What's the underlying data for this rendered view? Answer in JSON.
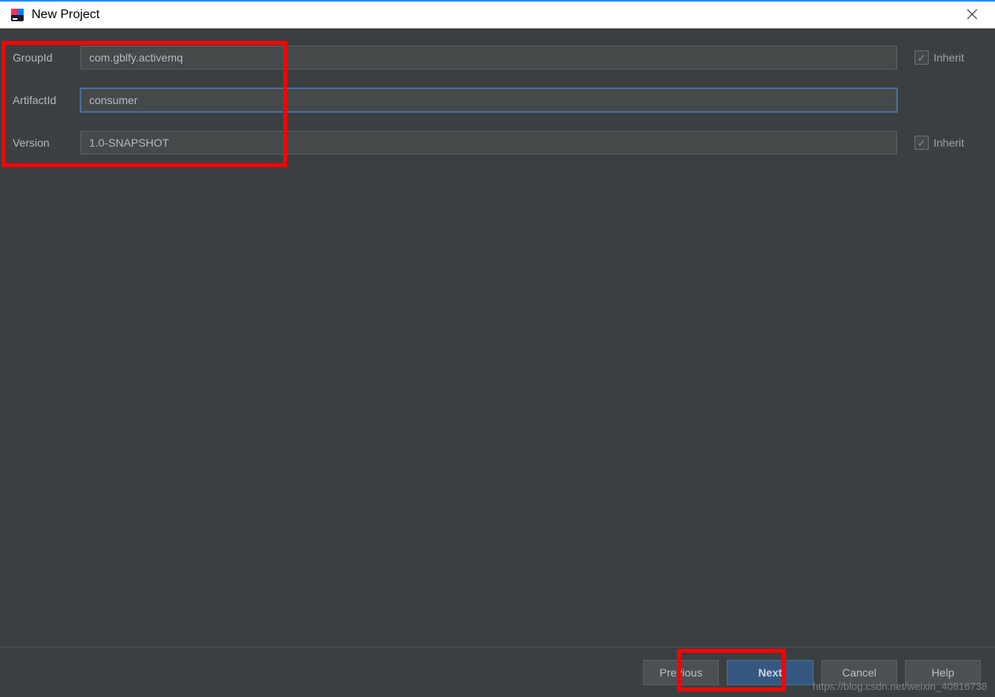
{
  "window": {
    "title": "New Project"
  },
  "form": {
    "groupIdLabel": "GroupId",
    "groupIdValue": "com.gblfy.activemq",
    "artifactIdLabel": "ArtifactId",
    "artifactIdValue": "consumer",
    "versionLabel": "Version",
    "versionValue": "1.0-SNAPSHOT",
    "inheritLabel": "Inherit"
  },
  "buttons": {
    "previous": "Previous",
    "next": "Next",
    "cancel": "Cancel",
    "help": "Help"
  },
  "watermark": "https://blog.csdn.net/weixin_40816738"
}
